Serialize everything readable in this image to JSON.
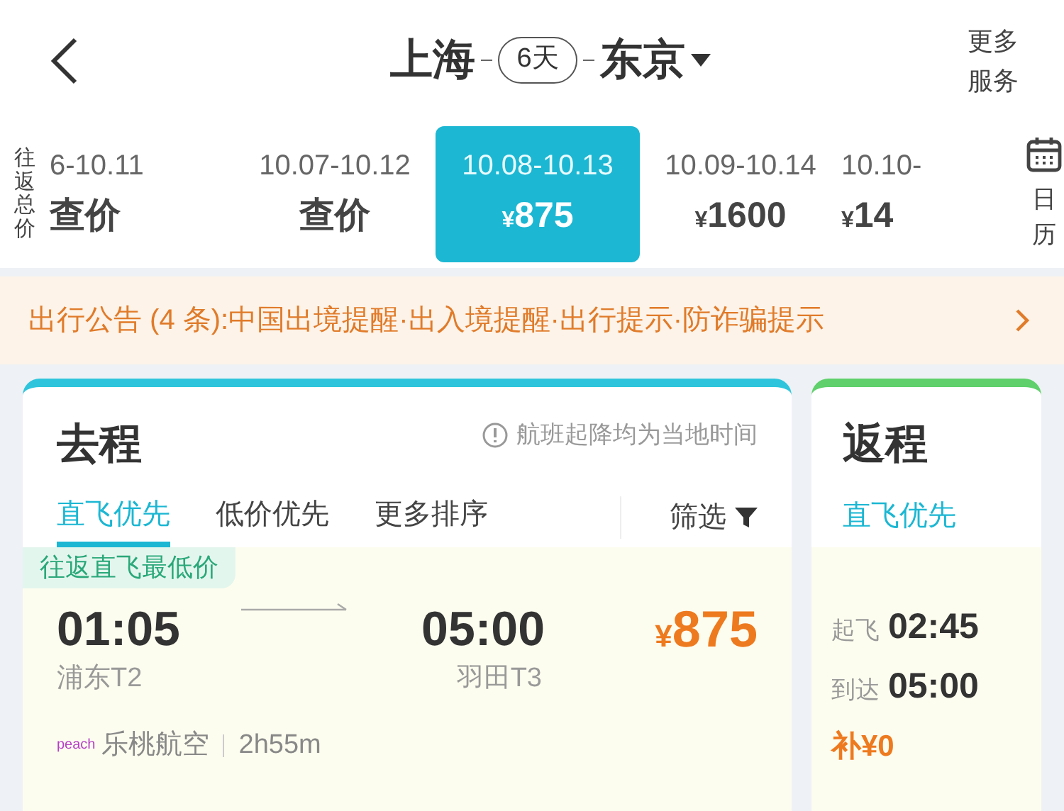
{
  "header": {
    "origin": "上海",
    "days": "6天",
    "destination": "东京",
    "more": "更多服务"
  },
  "date_strip": {
    "label": "往返总价",
    "calendar": "日历",
    "dates": [
      {
        "range": "6-10.11",
        "price": "查价",
        "selected": false
      },
      {
        "range": "10.07-10.12",
        "price": "查价",
        "selected": false
      },
      {
        "range": "10.08-10.13",
        "price": "¥875",
        "selected": true
      },
      {
        "range": "10.09-10.14",
        "price": "¥1600",
        "selected": false
      },
      {
        "range": "10.10-",
        "price": "¥14",
        "selected": false
      }
    ]
  },
  "notice": {
    "text": "出行公告 (4 条):中国出境提醒·出入境提醒·出行提示·防诈骗提示"
  },
  "outbound": {
    "title": "去程",
    "note": "航班起降均为当地时间",
    "filter": "筛选",
    "sorts": [
      {
        "label": "直飞优先",
        "selected": true
      },
      {
        "label": "低价优先",
        "selected": false
      },
      {
        "label": "更多排序",
        "selected": false
      }
    ],
    "flight": {
      "badge": "往返直飞最低价",
      "depart_time": "01:05",
      "depart_airport": "浦东T2",
      "arrive_time": "05:00",
      "arrive_airport": "羽田T3",
      "currency": "¥",
      "price": "875",
      "airline_logo": "peach",
      "airline": "乐桃航空",
      "duration": "2h55m"
    }
  },
  "return": {
    "title": "返程",
    "sorts": [
      {
        "label": "直飞优先",
        "selected": true
      }
    ],
    "flight": {
      "depart_label": "起飞",
      "depart_time": "02:45",
      "arrive_label": "到达",
      "arrive_time": "05:00",
      "extra": "补¥0"
    }
  }
}
